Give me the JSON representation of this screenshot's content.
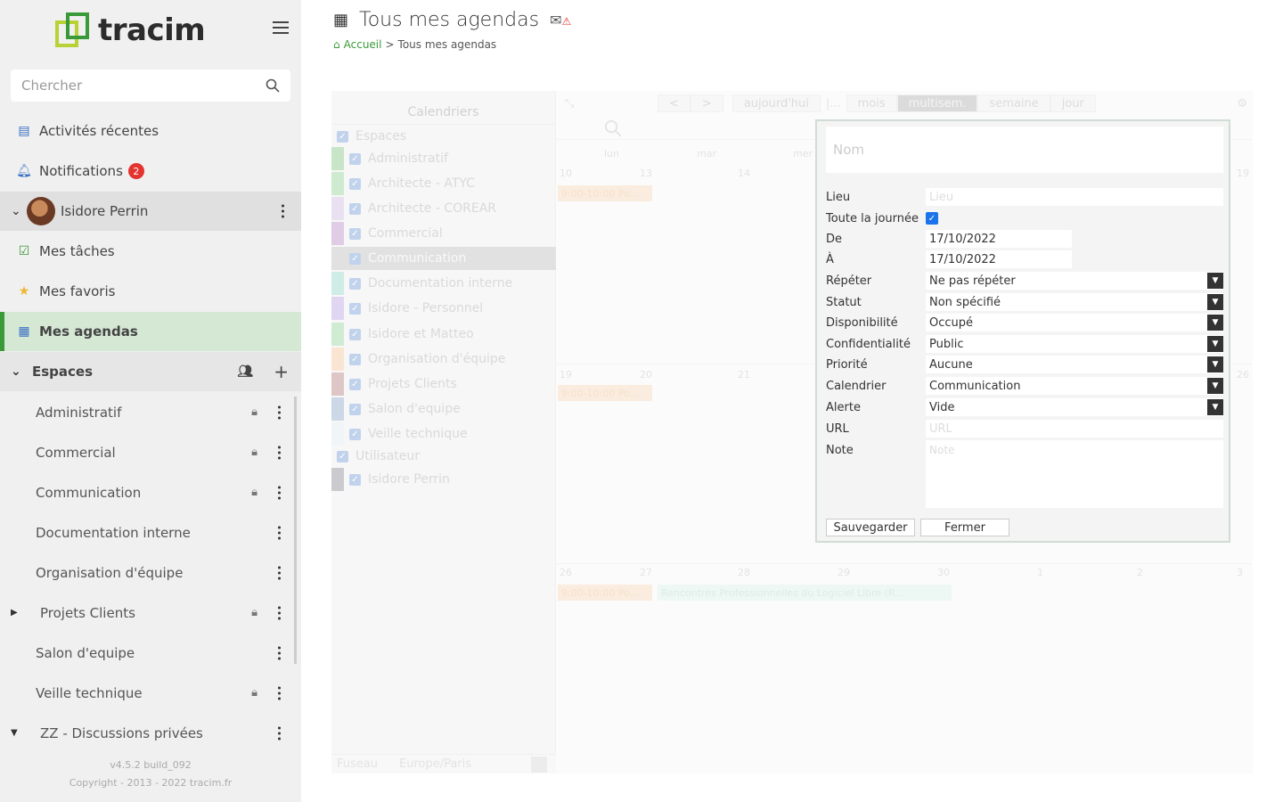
{
  "app": {
    "name": "tracim"
  },
  "search": {
    "placeholder": "Chercher"
  },
  "nav": {
    "recent": "Activités récentes",
    "notifications": "Notifications",
    "notifications_count": "2",
    "user": "Isidore Perrin",
    "tasks": "Mes tâches",
    "favorites": "Mes favoris",
    "agendas": "Mes agendas",
    "spaces": "Espaces"
  },
  "spaces": [
    {
      "label": "Administratif",
      "lock": true
    },
    {
      "label": "Commercial",
      "lock": true
    },
    {
      "label": "Communication",
      "lock": true
    },
    {
      "label": "Documentation interne",
      "lock": false
    },
    {
      "label": "Organisation d'équipe",
      "lock": false
    },
    {
      "label": "Projets Clients",
      "lock": true
    },
    {
      "label": "Salon d'equipe",
      "lock": false
    },
    {
      "label": "Veille technique",
      "lock": true
    },
    {
      "label": "ZZ - Discussions privées",
      "lock": false
    }
  ],
  "footer": {
    "version": "v4.5.2 build_092",
    "copyright": "Copyright - 2013 - 2022 tracim.fr"
  },
  "header": {
    "title": "Tous mes agendas",
    "breadcrumb_home": "Accueil",
    "breadcrumb_sep": ">",
    "breadcrumb_current": "Tous mes agendas"
  },
  "calendars": {
    "title": "Calendriers",
    "group_spaces": "Espaces",
    "group_users": "Utilisateur",
    "items": [
      {
        "label": "Administratif",
        "color": "#9ccf9c"
      },
      {
        "label": "Architecte - ATYC",
        "color": "#a8dba8"
      },
      {
        "label": "Architecte - COREAR",
        "color": "#d8c8e6"
      },
      {
        "label": "Commercial",
        "color": "#c9a3cf"
      },
      {
        "label": "Communication",
        "color": "#c8c8c8"
      },
      {
        "label": "Documentation interne",
        "color": "#a8dcd4"
      },
      {
        "label": "Isidore - Personnel",
        "color": "#c8b4e8"
      },
      {
        "label": "Isidore et Matteo",
        "color": "#a8dcb0"
      },
      {
        "label": "Organisation d'équipe",
        "color": "#f6d0b0"
      },
      {
        "label": "Projets Clients",
        "color": "#c49898"
      },
      {
        "label": "Salon d'equipe",
        "color": "#a4b8d4"
      },
      {
        "label": "Veille technique",
        "color": "#e4eef0"
      },
      {
        "label": "Isidore Perrin",
        "color": "#a0a0a8"
      }
    ],
    "timezone_label": "Fuseau",
    "timezone_value": "Europe/Paris"
  },
  "toolbar": {
    "prev": "<",
    "next": ">",
    "today": "aujourd'hui",
    "sep": "|...",
    "month": "mois",
    "multiweek": "multisem.",
    "week": "semaine",
    "day": "jour"
  },
  "grid": {
    "days": [
      "lun",
      "mar",
      "mer"
    ],
    "week1": [
      "10",
      "13",
      "14",
      "19"
    ],
    "week2": [
      "19",
      "20",
      "21",
      "26"
    ],
    "week3": [
      "26",
      "27",
      "28",
      "29",
      "30",
      "1",
      "2",
      "3"
    ],
    "event_short": "9:00-10:00 Po...",
    "event_long": "Rencontres Professionnelles du Logiciel Libre (R..."
  },
  "dialog": {
    "name_placeholder": "Nom",
    "location_label": "Lieu",
    "location_placeholder": "Lieu",
    "allday_label": "Toute la journée",
    "from_label": "De",
    "from_value": "17/10/2022",
    "to_label": "À",
    "to_value": "17/10/2022",
    "repeat_label": "Répéter",
    "repeat_value": "Ne pas répéter",
    "status_label": "Statut",
    "status_value": "Non spécifié",
    "availability_label": "Disponibilité",
    "availability_value": "Occupé",
    "privacy_label": "Confidentialité",
    "privacy_value": "Public",
    "priority_label": "Priorité",
    "priority_value": "Aucune",
    "calendar_label": "Calendrier",
    "calendar_value": "Communication",
    "alarm_label": "Alerte",
    "alarm_value": "Vide",
    "url_label": "URL",
    "url_placeholder": "URL",
    "note_label": "Note",
    "note_placeholder": "Note",
    "save": "Sauvegarder",
    "close": "Fermer"
  },
  "colors": {
    "accent": "#3a9a3a",
    "active_bg": "#d5e8d4",
    "badge": "#e3342f"
  }
}
